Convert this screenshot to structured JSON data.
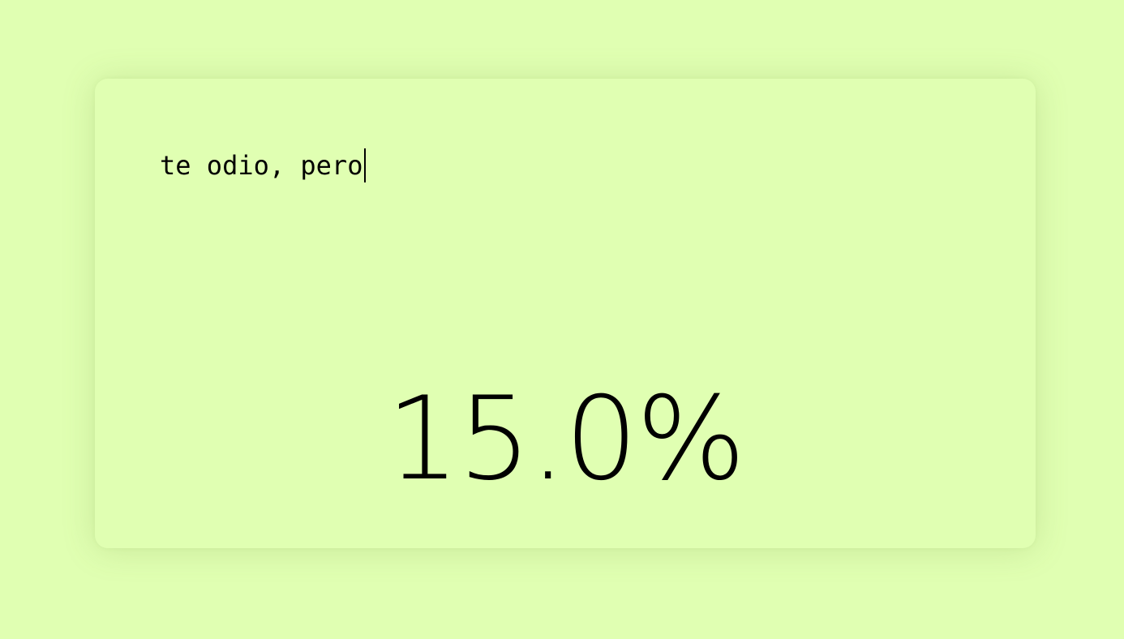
{
  "colors": {
    "background": "#e0ffb2",
    "card": "#e0ffb2",
    "text": "#000000"
  },
  "input": {
    "value": "te odio, pero"
  },
  "result": {
    "percentage_label": "15.0%",
    "percentage_value": 15.0
  }
}
